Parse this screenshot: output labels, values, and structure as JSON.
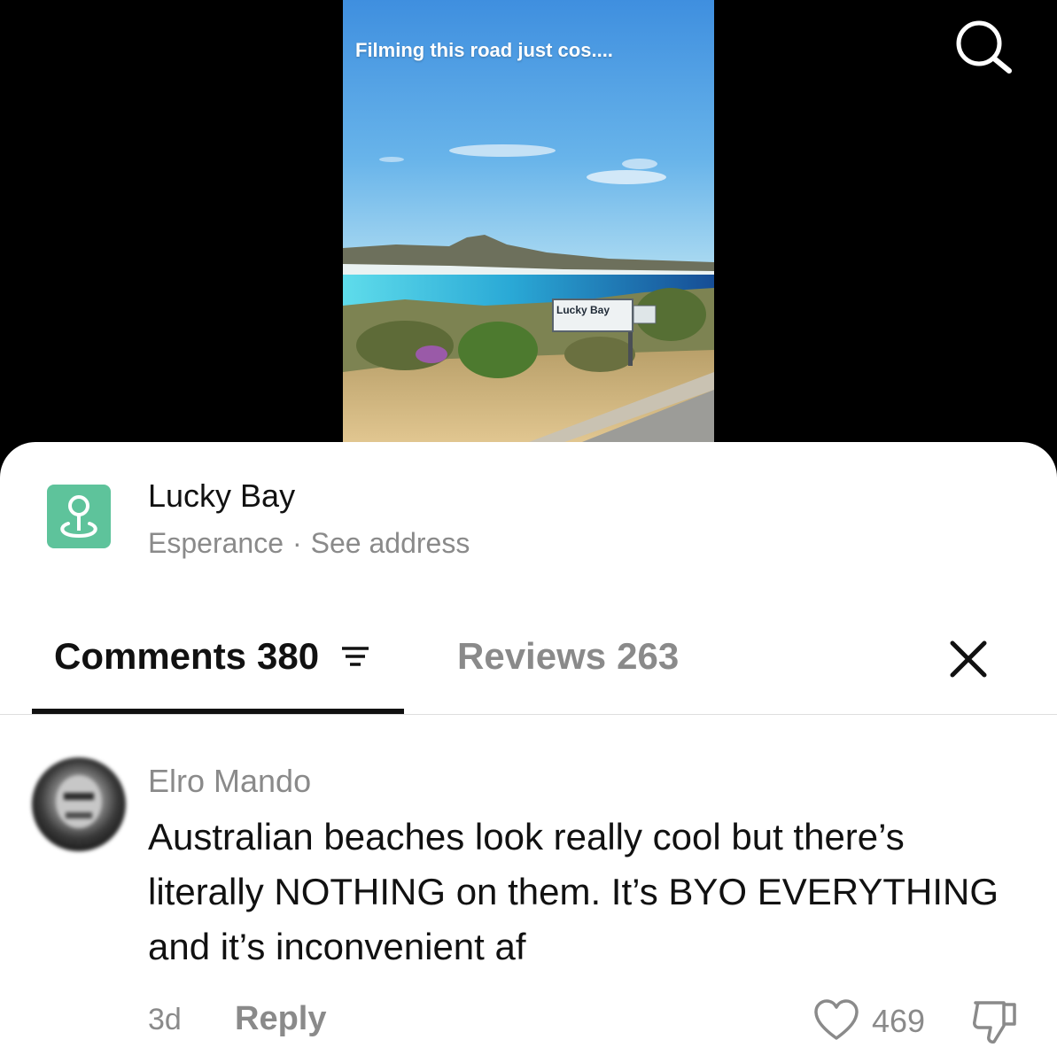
{
  "video": {
    "caption": "Filming this road just cos....",
    "sign_text": "Lucky Bay"
  },
  "header": {
    "search_icon": "search-icon"
  },
  "location": {
    "icon": "map-pin-icon",
    "name": "Lucky Bay",
    "city": "Esperance",
    "separator": "·",
    "address_link": "See address"
  },
  "tabs": {
    "comments": {
      "label": "Comments",
      "count": "380",
      "icon": "sort-icon",
      "active": true
    },
    "reviews": {
      "label": "Reviews",
      "count": "263",
      "active": false
    },
    "close_icon": "close-icon"
  },
  "comments": [
    {
      "author": "Elro Mando",
      "text": "Australian beaches look really cool but there’s literally NOTHING on them. It’s BYO EVERYTHING and it’s inconvenient af",
      "age": "3d",
      "reply_label": "Reply",
      "likes": "469",
      "like_icon": "heart-icon",
      "dislike_icon": "thumbs-down-icon"
    }
  ],
  "colors": {
    "pin_tile": "#5ec39b",
    "text_primary": "#111111",
    "text_secondary": "#8a8a8a",
    "sky": "#4ea3e4",
    "sea": "#1a5aa0",
    "lagoon": "#4fd3e6"
  }
}
